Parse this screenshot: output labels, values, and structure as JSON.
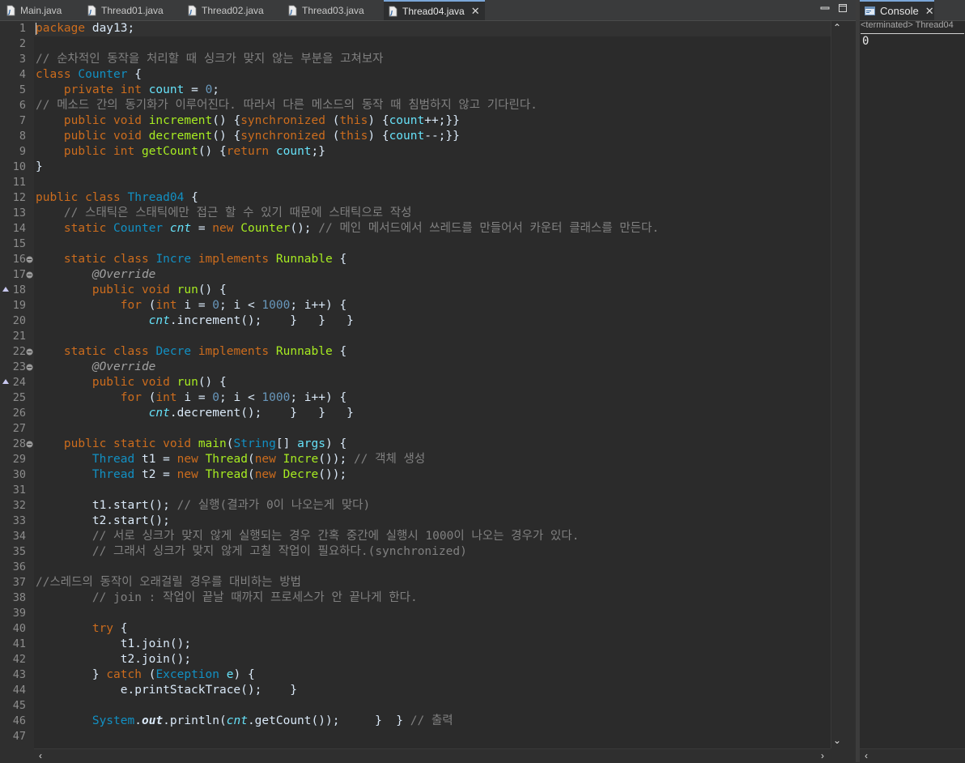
{
  "tabs": [
    {
      "name": "Main.java",
      "active": false
    },
    {
      "name": "Thread01.java",
      "active": false
    },
    {
      "name": "Thread02.java",
      "active": false
    },
    {
      "name": "Thread03.java",
      "active": false
    },
    {
      "name": "Thread04.java",
      "active": true
    }
  ],
  "console": {
    "tab_label": "Console",
    "status": "<terminated> Thread04",
    "output": "0"
  },
  "colors": {
    "keyword": "#cc6c1d",
    "type": "#1290c3",
    "method": "#a7ec21",
    "field": "#66e1f8",
    "comment": "#808080",
    "number": "#6897bb",
    "annotation": "#a0a0a0",
    "default": "#d9e8f7",
    "background": "#2b2b2b"
  },
  "code": {
    "lines": [
      {
        "n": "1",
        "tokens": [
          [
            "kw",
            "package"
          ],
          [
            "df",
            " day13;"
          ]
        ]
      },
      {
        "n": "2",
        "tokens": []
      },
      {
        "n": "3",
        "tokens": [
          [
            "cm",
            "// 순차적인 동작을 처리할 때 싱크가 맞지 않는 부분을 고쳐보자"
          ]
        ]
      },
      {
        "n": "4",
        "tokens": [
          [
            "kw",
            "class"
          ],
          [
            "df",
            " "
          ],
          [
            "ty",
            "Counter"
          ],
          [
            "df",
            " {"
          ]
        ]
      },
      {
        "n": "5",
        "tokens": [
          [
            "df",
            "    "
          ],
          [
            "kw",
            "private"
          ],
          [
            "df",
            " "
          ],
          [
            "kw",
            "int"
          ],
          [
            "df",
            " "
          ],
          [
            "fi",
            "count"
          ],
          [
            "df",
            " = "
          ],
          [
            "nu",
            "0"
          ],
          [
            "df",
            ";"
          ]
        ]
      },
      {
        "n": "6",
        "tokens": [
          [
            "cm",
            "// 메소드 간의 동기화가 이루어진다. 따라서 다른 메소드의 동작 때 침범하지 않고 기다린다."
          ]
        ]
      },
      {
        "n": "7",
        "tokens": [
          [
            "df",
            "    "
          ],
          [
            "kw",
            "public"
          ],
          [
            "df",
            " "
          ],
          [
            "kw",
            "void"
          ],
          [
            "df",
            " "
          ],
          [
            "fn",
            "increment"
          ],
          [
            "df",
            "() {"
          ],
          [
            "kw",
            "synchronized"
          ],
          [
            "df",
            " ("
          ],
          [
            "kw",
            "this"
          ],
          [
            "df",
            ") {"
          ],
          [
            "fi",
            "count"
          ],
          [
            "df",
            "++;}}"
          ]
        ]
      },
      {
        "n": "8",
        "tokens": [
          [
            "df",
            "    "
          ],
          [
            "kw",
            "public"
          ],
          [
            "df",
            " "
          ],
          [
            "kw",
            "void"
          ],
          [
            "df",
            " "
          ],
          [
            "fn",
            "decrement"
          ],
          [
            "df",
            "() {"
          ],
          [
            "kw",
            "synchronized"
          ],
          [
            "df",
            " ("
          ],
          [
            "kw",
            "this"
          ],
          [
            "df",
            ") {"
          ],
          [
            "fi",
            "count"
          ],
          [
            "df",
            "--;}}"
          ]
        ]
      },
      {
        "n": "9",
        "tokens": [
          [
            "df",
            "    "
          ],
          [
            "kw",
            "public"
          ],
          [
            "df",
            " "
          ],
          [
            "kw",
            "int"
          ],
          [
            "df",
            " "
          ],
          [
            "fn",
            "getCount"
          ],
          [
            "df",
            "() {"
          ],
          [
            "kw",
            "return"
          ],
          [
            "df",
            " "
          ],
          [
            "fi",
            "count"
          ],
          [
            "df",
            ";}"
          ]
        ]
      },
      {
        "n": "10",
        "tokens": [
          [
            "df",
            "}"
          ]
        ]
      },
      {
        "n": "11",
        "tokens": []
      },
      {
        "n": "12",
        "tokens": [
          [
            "kw",
            "public"
          ],
          [
            "df",
            " "
          ],
          [
            "kw",
            "class"
          ],
          [
            "df",
            " "
          ],
          [
            "ty",
            "Thread04"
          ],
          [
            "df",
            " {"
          ]
        ]
      },
      {
        "n": "13",
        "tokens": [
          [
            "df",
            "    "
          ],
          [
            "cm",
            "// 스태틱은 스태틱에만 접근 할 수 있기 때문에 스태틱으로 작성"
          ]
        ]
      },
      {
        "n": "14",
        "tokens": [
          [
            "df",
            "    "
          ],
          [
            "kw",
            "static"
          ],
          [
            "df",
            " "
          ],
          [
            "ty",
            "Counter"
          ],
          [
            "df",
            " "
          ],
          [
            "it",
            "cnt"
          ],
          [
            "df",
            " = "
          ],
          [
            "kw",
            "new"
          ],
          [
            "df",
            " "
          ],
          [
            "fn",
            "Counter"
          ],
          [
            "df",
            "(); "
          ],
          [
            "cm",
            "// 메인 메서드에서 쓰레드를 만들어서 카운터 클래스를 만든다."
          ]
        ]
      },
      {
        "n": "15",
        "tokens": []
      },
      {
        "n": "16",
        "fold": true,
        "tokens": [
          [
            "df",
            "    "
          ],
          [
            "kw",
            "static"
          ],
          [
            "df",
            " "
          ],
          [
            "kw",
            "class"
          ],
          [
            "df",
            " "
          ],
          [
            "ty",
            "Incre"
          ],
          [
            "df",
            " "
          ],
          [
            "kw",
            "implements"
          ],
          [
            "df",
            " "
          ],
          [
            "fn",
            "Runnable"
          ],
          [
            "df",
            " {"
          ]
        ]
      },
      {
        "n": "17",
        "fold": true,
        "tokens": [
          [
            "df",
            "        "
          ],
          [
            "an",
            "@Override"
          ]
        ]
      },
      {
        "n": "18",
        "ovr": true,
        "tokens": [
          [
            "df",
            "        "
          ],
          [
            "kw",
            "public"
          ],
          [
            "df",
            " "
          ],
          [
            "kw",
            "void"
          ],
          [
            "df",
            " "
          ],
          [
            "fn",
            "run"
          ],
          [
            "df",
            "() {"
          ]
        ]
      },
      {
        "n": "19",
        "tokens": [
          [
            "df",
            "            "
          ],
          [
            "kw",
            "for"
          ],
          [
            "df",
            " ("
          ],
          [
            "kw",
            "int"
          ],
          [
            "df",
            " i = "
          ],
          [
            "nu",
            "0"
          ],
          [
            "df",
            "; i < "
          ],
          [
            "nu",
            "1000"
          ],
          [
            "df",
            "; i++) {"
          ]
        ]
      },
      {
        "n": "20",
        "tokens": [
          [
            "df",
            "                "
          ],
          [
            "it",
            "cnt"
          ],
          [
            "df",
            "."
          ],
          [
            "df",
            "increment();    }   }   }"
          ]
        ]
      },
      {
        "n": "21",
        "tokens": []
      },
      {
        "n": "22",
        "fold": true,
        "tokens": [
          [
            "df",
            "    "
          ],
          [
            "kw",
            "static"
          ],
          [
            "df",
            " "
          ],
          [
            "kw",
            "class"
          ],
          [
            "df",
            " "
          ],
          [
            "ty",
            "Decre"
          ],
          [
            "df",
            " "
          ],
          [
            "kw",
            "implements"
          ],
          [
            "df",
            " "
          ],
          [
            "fn",
            "Runnable"
          ],
          [
            "df",
            " {"
          ]
        ]
      },
      {
        "n": "23",
        "fold": true,
        "tokens": [
          [
            "df",
            "        "
          ],
          [
            "an",
            "@Override"
          ]
        ]
      },
      {
        "n": "24",
        "ovr": true,
        "tokens": [
          [
            "df",
            "        "
          ],
          [
            "kw",
            "public"
          ],
          [
            "df",
            " "
          ],
          [
            "kw",
            "void"
          ],
          [
            "df",
            " "
          ],
          [
            "fn",
            "run"
          ],
          [
            "df",
            "() {"
          ]
        ]
      },
      {
        "n": "25",
        "tokens": [
          [
            "df",
            "            "
          ],
          [
            "kw",
            "for"
          ],
          [
            "df",
            " ("
          ],
          [
            "kw",
            "int"
          ],
          [
            "df",
            " i = "
          ],
          [
            "nu",
            "0"
          ],
          [
            "df",
            "; i < "
          ],
          [
            "nu",
            "1000"
          ],
          [
            "df",
            "; i++) {"
          ]
        ]
      },
      {
        "n": "26",
        "tokens": [
          [
            "df",
            "                "
          ],
          [
            "it",
            "cnt"
          ],
          [
            "df",
            "."
          ],
          [
            "df",
            "decrement();    }   }   }"
          ]
        ]
      },
      {
        "n": "27",
        "tokens": []
      },
      {
        "n": "28",
        "fold": true,
        "tokens": [
          [
            "df",
            "    "
          ],
          [
            "kw",
            "public"
          ],
          [
            "df",
            " "
          ],
          [
            "kw",
            "static"
          ],
          [
            "df",
            " "
          ],
          [
            "kw",
            "void"
          ],
          [
            "df",
            " "
          ],
          [
            "fn",
            "main"
          ],
          [
            "df",
            "("
          ],
          [
            "ty",
            "String"
          ],
          [
            "df",
            "[] "
          ],
          [
            "fi",
            "args"
          ],
          [
            "df",
            ") {"
          ]
        ]
      },
      {
        "n": "29",
        "tokens": [
          [
            "df",
            "        "
          ],
          [
            "ty",
            "Thread"
          ],
          [
            "df",
            " t1 = "
          ],
          [
            "kw",
            "new"
          ],
          [
            "df",
            " "
          ],
          [
            "fn",
            "Thread"
          ],
          [
            "df",
            "("
          ],
          [
            "kw",
            "new"
          ],
          [
            "df",
            " "
          ],
          [
            "fn",
            "Incre"
          ],
          [
            "df",
            "()); "
          ],
          [
            "cm",
            "// 객체 생성"
          ]
        ]
      },
      {
        "n": "30",
        "tokens": [
          [
            "df",
            "        "
          ],
          [
            "ty",
            "Thread"
          ],
          [
            "df",
            " t2 = "
          ],
          [
            "kw",
            "new"
          ],
          [
            "df",
            " "
          ],
          [
            "fn",
            "Thread"
          ],
          [
            "df",
            "("
          ],
          [
            "kw",
            "new"
          ],
          [
            "df",
            " "
          ],
          [
            "fn",
            "Decre"
          ],
          [
            "df",
            "());"
          ]
        ]
      },
      {
        "n": "31",
        "tokens": []
      },
      {
        "n": "32",
        "tokens": [
          [
            "df",
            "        t1.start(); "
          ],
          [
            "cm",
            "// 실행(결과가 0이 나오는게 맞다)"
          ]
        ]
      },
      {
        "n": "33",
        "tokens": [
          [
            "df",
            "        t2.start();"
          ]
        ]
      },
      {
        "n": "34",
        "tokens": [
          [
            "df",
            "        "
          ],
          [
            "cm",
            "// 서로 싱크가 맞지 않게 실행되는 경우 간혹 중간에 실행시 1000이 나오는 경우가 있다."
          ]
        ]
      },
      {
        "n": "35",
        "tokens": [
          [
            "df",
            "        "
          ],
          [
            "cm",
            "// 그래서 싱크가 맞지 않게 고칠 작업이 필요하다.(synchronized)"
          ]
        ]
      },
      {
        "n": "36",
        "tokens": []
      },
      {
        "n": "37",
        "tokens": [
          [
            "cm",
            "//스레드의 동작이 오래걸릴 경우를 대비하는 방법"
          ]
        ]
      },
      {
        "n": "38",
        "tokens": [
          [
            "df",
            "        "
          ],
          [
            "cm",
            "// join : 작업이 끝날 때까지 프로세스가 안 끝나게 한다."
          ]
        ]
      },
      {
        "n": "39",
        "tokens": []
      },
      {
        "n": "40",
        "tokens": [
          [
            "df",
            "        "
          ],
          [
            "kw",
            "try"
          ],
          [
            "df",
            " {"
          ]
        ]
      },
      {
        "n": "41",
        "tokens": [
          [
            "df",
            "            t1.join();"
          ]
        ]
      },
      {
        "n": "42",
        "tokens": [
          [
            "df",
            "            t2.join();"
          ]
        ]
      },
      {
        "n": "43",
        "tokens": [
          [
            "df",
            "        } "
          ],
          [
            "kw",
            "catch"
          ],
          [
            "df",
            " ("
          ],
          [
            "ty",
            "Exception"
          ],
          [
            "df",
            " "
          ],
          [
            "fi",
            "e"
          ],
          [
            "df",
            ") {"
          ]
        ]
      },
      {
        "n": "44",
        "tokens": [
          [
            "df",
            "            e.printStackTrace();    }"
          ]
        ]
      },
      {
        "n": "45",
        "tokens": []
      },
      {
        "n": "46",
        "tokens": [
          [
            "df",
            "        "
          ],
          [
            "ty",
            "System"
          ],
          [
            "df",
            "."
          ],
          [
            "bo",
            "out"
          ],
          [
            "df",
            ".println("
          ],
          [
            "it",
            "cnt"
          ],
          [
            "df",
            ".getCount());     }  } "
          ],
          [
            "cm",
            "// 출력"
          ]
        ]
      },
      {
        "n": "47",
        "tokens": []
      }
    ]
  }
}
